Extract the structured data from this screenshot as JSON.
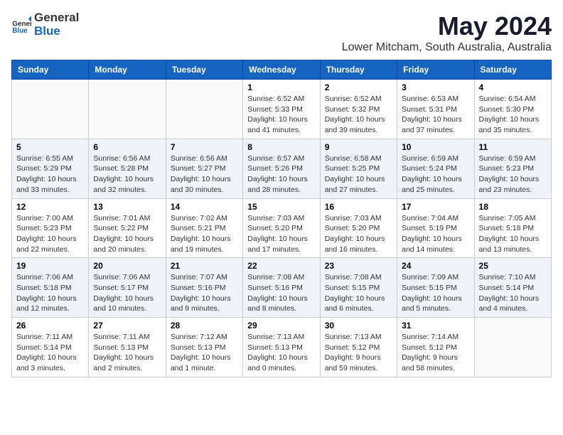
{
  "header": {
    "logo_general": "General",
    "logo_blue": "Blue",
    "month_title": "May 2024",
    "location": "Lower Mitcham, South Australia, Australia"
  },
  "weekdays": [
    "Sunday",
    "Monday",
    "Tuesday",
    "Wednesday",
    "Thursday",
    "Friday",
    "Saturday"
  ],
  "weeks": [
    {
      "shaded": false,
      "days": [
        {
          "num": "",
          "info": ""
        },
        {
          "num": "",
          "info": ""
        },
        {
          "num": "",
          "info": ""
        },
        {
          "num": "1",
          "info": "Sunrise: 6:52 AM\nSunset: 5:33 PM\nDaylight: 10 hours\nand 41 minutes."
        },
        {
          "num": "2",
          "info": "Sunrise: 6:52 AM\nSunset: 5:32 PM\nDaylight: 10 hours\nand 39 minutes."
        },
        {
          "num": "3",
          "info": "Sunrise: 6:53 AM\nSunset: 5:31 PM\nDaylight: 10 hours\nand 37 minutes."
        },
        {
          "num": "4",
          "info": "Sunrise: 6:54 AM\nSunset: 5:30 PM\nDaylight: 10 hours\nand 35 minutes."
        }
      ]
    },
    {
      "shaded": true,
      "days": [
        {
          "num": "5",
          "info": "Sunrise: 6:55 AM\nSunset: 5:29 PM\nDaylight: 10 hours\nand 33 minutes."
        },
        {
          "num": "6",
          "info": "Sunrise: 6:56 AM\nSunset: 5:28 PM\nDaylight: 10 hours\nand 32 minutes."
        },
        {
          "num": "7",
          "info": "Sunrise: 6:56 AM\nSunset: 5:27 PM\nDaylight: 10 hours\nand 30 minutes."
        },
        {
          "num": "8",
          "info": "Sunrise: 6:57 AM\nSunset: 5:26 PM\nDaylight: 10 hours\nand 28 minutes."
        },
        {
          "num": "9",
          "info": "Sunrise: 6:58 AM\nSunset: 5:25 PM\nDaylight: 10 hours\nand 27 minutes."
        },
        {
          "num": "10",
          "info": "Sunrise: 6:59 AM\nSunset: 5:24 PM\nDaylight: 10 hours\nand 25 minutes."
        },
        {
          "num": "11",
          "info": "Sunrise: 6:59 AM\nSunset: 5:23 PM\nDaylight: 10 hours\nand 23 minutes."
        }
      ]
    },
    {
      "shaded": false,
      "days": [
        {
          "num": "12",
          "info": "Sunrise: 7:00 AM\nSunset: 5:23 PM\nDaylight: 10 hours\nand 22 minutes."
        },
        {
          "num": "13",
          "info": "Sunrise: 7:01 AM\nSunset: 5:22 PM\nDaylight: 10 hours\nand 20 minutes."
        },
        {
          "num": "14",
          "info": "Sunrise: 7:02 AM\nSunset: 5:21 PM\nDaylight: 10 hours\nand 19 minutes."
        },
        {
          "num": "15",
          "info": "Sunrise: 7:03 AM\nSunset: 5:20 PM\nDaylight: 10 hours\nand 17 minutes."
        },
        {
          "num": "16",
          "info": "Sunrise: 7:03 AM\nSunset: 5:20 PM\nDaylight: 10 hours\nand 16 minutes."
        },
        {
          "num": "17",
          "info": "Sunrise: 7:04 AM\nSunset: 5:19 PM\nDaylight: 10 hours\nand 14 minutes."
        },
        {
          "num": "18",
          "info": "Sunrise: 7:05 AM\nSunset: 5:18 PM\nDaylight: 10 hours\nand 13 minutes."
        }
      ]
    },
    {
      "shaded": true,
      "days": [
        {
          "num": "19",
          "info": "Sunrise: 7:06 AM\nSunset: 5:18 PM\nDaylight: 10 hours\nand 12 minutes."
        },
        {
          "num": "20",
          "info": "Sunrise: 7:06 AM\nSunset: 5:17 PM\nDaylight: 10 hours\nand 10 minutes."
        },
        {
          "num": "21",
          "info": "Sunrise: 7:07 AM\nSunset: 5:16 PM\nDaylight: 10 hours\nand 9 minutes."
        },
        {
          "num": "22",
          "info": "Sunrise: 7:08 AM\nSunset: 5:16 PM\nDaylight: 10 hours\nand 8 minutes."
        },
        {
          "num": "23",
          "info": "Sunrise: 7:08 AM\nSunset: 5:15 PM\nDaylight: 10 hours\nand 6 minutes."
        },
        {
          "num": "24",
          "info": "Sunrise: 7:09 AM\nSunset: 5:15 PM\nDaylight: 10 hours\nand 5 minutes."
        },
        {
          "num": "25",
          "info": "Sunrise: 7:10 AM\nSunset: 5:14 PM\nDaylight: 10 hours\nand 4 minutes."
        }
      ]
    },
    {
      "shaded": false,
      "days": [
        {
          "num": "26",
          "info": "Sunrise: 7:11 AM\nSunset: 5:14 PM\nDaylight: 10 hours\nand 3 minutes."
        },
        {
          "num": "27",
          "info": "Sunrise: 7:11 AM\nSunset: 5:13 PM\nDaylight: 10 hours\nand 2 minutes."
        },
        {
          "num": "28",
          "info": "Sunrise: 7:12 AM\nSunset: 5:13 PM\nDaylight: 10 hours\nand 1 minute."
        },
        {
          "num": "29",
          "info": "Sunrise: 7:13 AM\nSunset: 5:13 PM\nDaylight: 10 hours\nand 0 minutes."
        },
        {
          "num": "30",
          "info": "Sunrise: 7:13 AM\nSunset: 5:12 PM\nDaylight: 9 hours\nand 59 minutes."
        },
        {
          "num": "31",
          "info": "Sunrise: 7:14 AM\nSunset: 5:12 PM\nDaylight: 9 hours\nand 58 minutes."
        },
        {
          "num": "",
          "info": ""
        }
      ]
    }
  ]
}
